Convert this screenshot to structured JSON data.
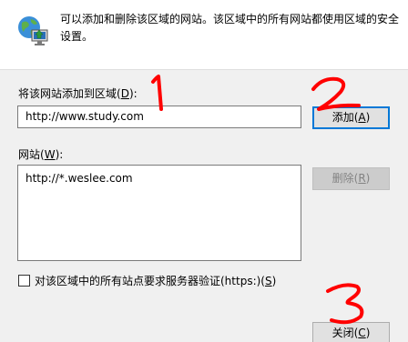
{
  "header": {
    "icon": "globe-monitor-icon",
    "description": "可以添加和删除该区域的网站。该区域中的所有网站都使用区域的安全设置。"
  },
  "add_section": {
    "label": "将该网站添加到区域(",
    "label_key": "D",
    "label_end": "):",
    "input_value": "http://www.study.com",
    "add_button": "添加(",
    "add_button_key": "A",
    "add_button_end": ")"
  },
  "sites_section": {
    "label": "网站(",
    "label_key": "W",
    "label_end": "):",
    "sites": [
      "http://*.weslee.com"
    ],
    "remove_button": "删除(",
    "remove_button_key": "R",
    "remove_button_end": ")"
  },
  "https_option": {
    "label": "对该区域中的所有站点要求服务器验证(https:)(",
    "label_key": "S",
    "label_end": ")",
    "checked": false
  },
  "close_button": {
    "label": "关闭(",
    "key": "C",
    "label_end": ")"
  },
  "annotations": {
    "color": "#ff0000",
    "marks": [
      "1",
      "2",
      "3"
    ]
  },
  "colors": {
    "body_background": "#f0f0f0",
    "header_background": "#ffffff",
    "focus_border": "#0078d7",
    "annotation_red": "#ff0000"
  }
}
